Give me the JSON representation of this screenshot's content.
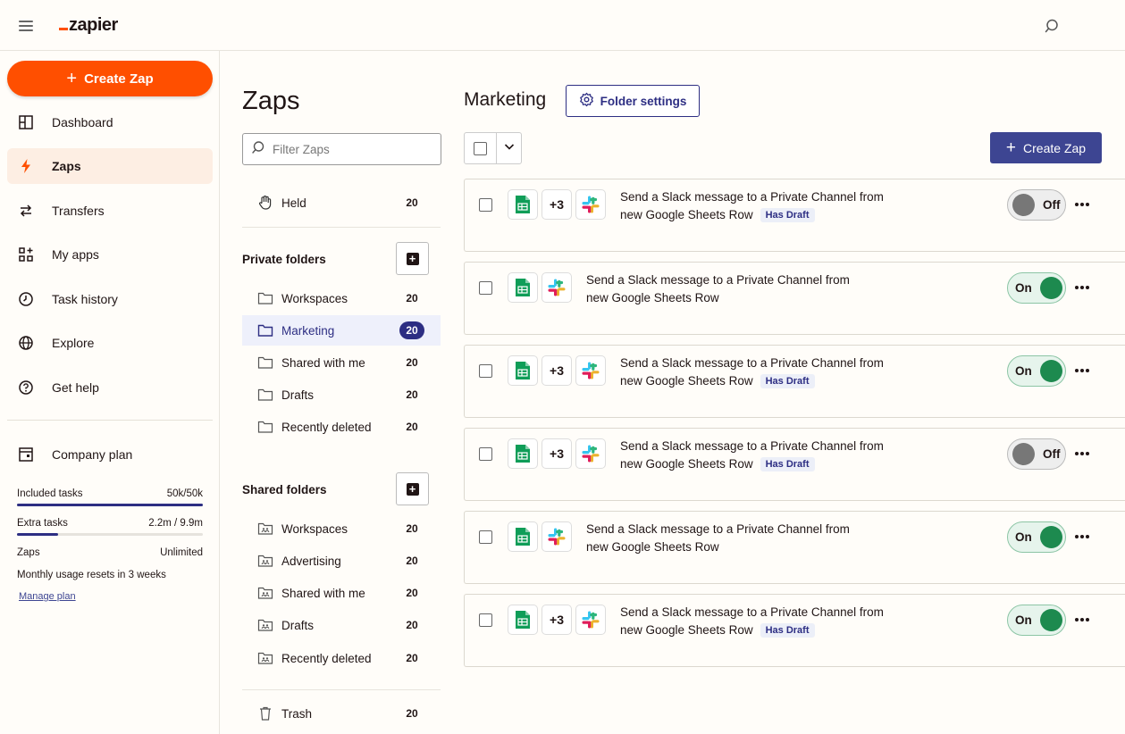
{
  "app": {
    "brand": "zapier"
  },
  "sidebar": {
    "create_label": "Create Zap",
    "items": [
      {
        "label": "Dashboard",
        "icon": "dashboard-icon"
      },
      {
        "label": "Zaps",
        "icon": "zap-bolt-icon",
        "active": true
      },
      {
        "label": "Transfers",
        "icon": "transfer-icon"
      },
      {
        "label": "My apps",
        "icon": "apps-grid-icon"
      },
      {
        "label": "Task history",
        "icon": "history-icon"
      },
      {
        "label": "Explore",
        "icon": "globe-icon"
      },
      {
        "label": "Get help",
        "icon": "help-icon"
      }
    ],
    "plan": {
      "label": "Company plan",
      "included_tasks_label": "Included tasks",
      "included_tasks_value": "50k/50k",
      "included_tasks_fraction": 1.0,
      "extra_tasks_label": "Extra tasks",
      "extra_tasks_value": "2.2m / 9.9m",
      "extra_tasks_fraction": 0.22,
      "zaps_label": "Zaps",
      "zaps_value": "Unlimited",
      "reset_text": "Monthly usage resets in 3 weeks",
      "manage_link": "Manage plan"
    }
  },
  "folders": {
    "title": "Zaps",
    "filter_placeholder": "Filter Zaps",
    "held": {
      "label": "Held",
      "count": "20"
    },
    "private_heading": "Private folders",
    "private": [
      {
        "label": "Workspaces",
        "count": "20"
      },
      {
        "label": "Marketing",
        "count": "20",
        "active": true
      },
      {
        "label": "Shared with me",
        "count": "20"
      },
      {
        "label": "Drafts",
        "count": "20"
      },
      {
        "label": "Recently deleted",
        "count": "20"
      }
    ],
    "shared_heading": "Shared folders",
    "shared": [
      {
        "label": "Workspaces",
        "count": "20"
      },
      {
        "label": "Advertising",
        "count": "20"
      },
      {
        "label": "Shared with me",
        "count": "20"
      },
      {
        "label": "Drafts",
        "count": "20"
      },
      {
        "label": "Recently deleted",
        "count": "20"
      }
    ],
    "trash": {
      "label": "Trash",
      "count": "20"
    }
  },
  "main": {
    "title": "Marketing",
    "folder_settings_label": "Folder settings",
    "create_label": "Create Zap",
    "zaps": [
      {
        "line1": "Send a Slack message to a Private Channel from",
        "line2": "new Google Sheets Row",
        "badge": "Has Draft",
        "extra_apps": "+3",
        "status": "Off"
      },
      {
        "line1": "Send a Slack message to a Private Channel from",
        "line2": "new Google Sheets Row",
        "badge": "",
        "extra_apps": "",
        "status": "On"
      },
      {
        "line1": "Send a Slack message to a Private Channel from",
        "line2": "new Google Sheets Row",
        "badge": "Has Draft",
        "extra_apps": "+3",
        "status": "On"
      },
      {
        "line1": "Send a Slack message to a Private Channel from",
        "line2": "new Google Sheets Row",
        "badge": "Has Draft",
        "extra_apps": "+3",
        "status": "Off"
      },
      {
        "line1": "Send a Slack message to a Private Channel from",
        "line2": "new Google Sheets Row",
        "badge": "",
        "extra_apps": "",
        "status": "On"
      },
      {
        "line1": "Send a Slack message to a Private Channel from",
        "line2": "new Google Sheets Row",
        "badge": "Has Draft",
        "extra_apps": "+3",
        "status": "On"
      }
    ]
  },
  "colors": {
    "accent": "#ff4f00",
    "brand_navy": "#2d2e83",
    "on_green": "#1d8a4f"
  }
}
